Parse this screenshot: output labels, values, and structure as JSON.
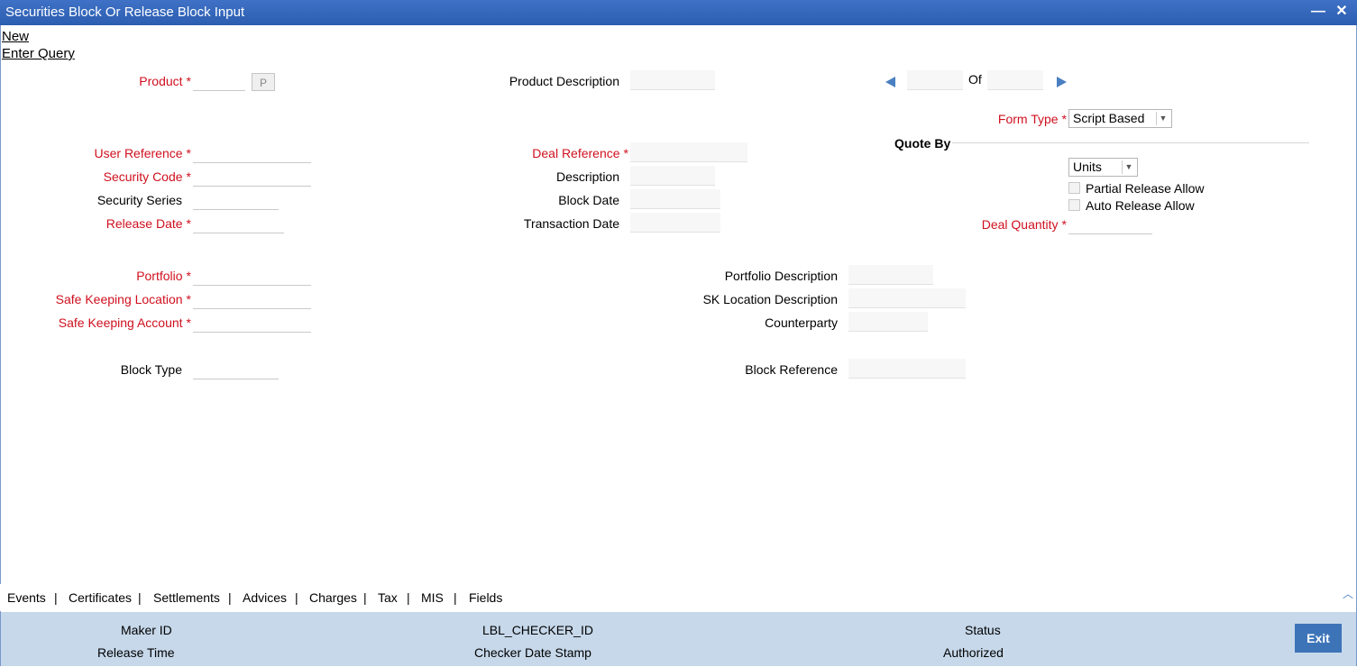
{
  "window": {
    "title": "Securities Block Or Release Block Input",
    "minimize": "—",
    "close": "✕"
  },
  "toolbar": {
    "new": "New",
    "enter_query": "Enter Query"
  },
  "form": {
    "product_label": "Product",
    "product_button": "P",
    "product_description_label": "Product Description",
    "of_label": "Of",
    "form_type_label": "Form Type",
    "form_type_value": "Script Based",
    "quote_by_label": "Quote By",
    "quote_by_value": "Units",
    "partial_release_label": "Partial Release Allow",
    "auto_release_label": "Auto Release Allow",
    "deal_quantity_label": "Deal Quantity",
    "user_reference_label": "User Reference",
    "security_code_label": "Security Code",
    "security_series_label": "Security Series",
    "release_date_label": "Release Date",
    "deal_reference_label": "Deal Reference",
    "description_label": "Description",
    "block_date_label": "Block Date",
    "transaction_date_label": "Transaction Date",
    "portfolio_label": "Portfolio",
    "safe_keeping_location_label": "Safe Keeping Location",
    "safe_keeping_account_label": "Safe Keeping Account",
    "block_type_label": "Block Type",
    "portfolio_description_label": "Portfolio Description",
    "sk_location_description_label": "SK Location Description",
    "counterparty_label": "Counterparty",
    "block_reference_label": "Block Reference",
    "required_mark": "*"
  },
  "tabs": [
    "Events",
    "Certificates",
    "Settlements",
    "Advices",
    "Charges",
    "Tax",
    "MIS",
    "Fields"
  ],
  "tab_separator": "|",
  "footer": {
    "maker_id": "Maker ID",
    "release_time": "Release Time",
    "checker_id": "LBL_CHECKER_ID",
    "checker_date_stamp": "Checker Date Stamp",
    "status": "Status",
    "authorized": "Authorized",
    "exit": "Exit"
  },
  "colors": {
    "title_bar": "#2b5db0",
    "required": "#d0101f",
    "footer_bg": "#c6d8ea",
    "exit_button": "#3d74b8"
  }
}
